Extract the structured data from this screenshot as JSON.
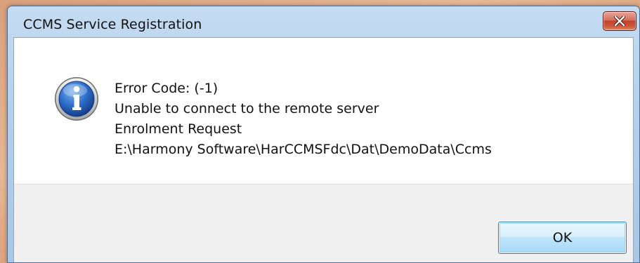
{
  "window": {
    "title": "CCMS Service Registration",
    "close_icon": "close-icon"
  },
  "message": {
    "icon": "info-icon",
    "lines": [
      "Error Code: (-1)",
      "Unable to connect to the remote server",
      "Enrolment Request",
      "E:\\Harmony Software\\HarCCMSFdc\\Dat\\DemoData\\Ccms"
    ]
  },
  "buttons": {
    "ok_label": "OK"
  },
  "colors": {
    "title_bar": "#b4d0ec",
    "close_button": "#c1412a",
    "info_icon": "#1f5fb8",
    "ok_button_border": "#3c7fb1"
  }
}
